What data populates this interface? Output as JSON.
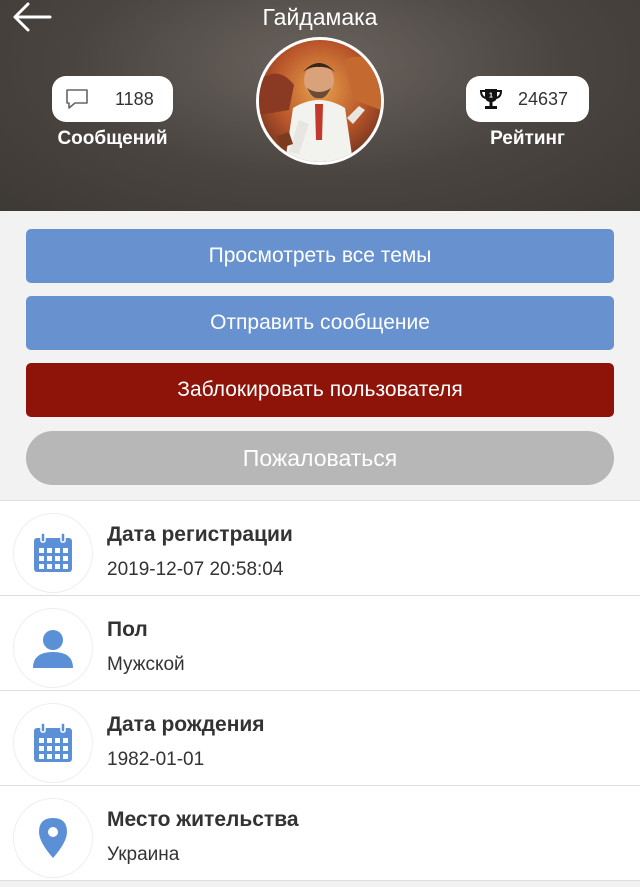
{
  "header": {
    "title": "Гайдамака",
    "messages": {
      "count": "1188",
      "label": "Сообщений",
      "icon": "speech-bubble-icon"
    },
    "rating": {
      "value": "24637",
      "label": "Рейтинг",
      "icon": "trophy-icon"
    },
    "back_icon": "arrow-left-icon"
  },
  "actions": {
    "view_topics": "Просмотреть все темы",
    "send_message": "Отправить сообщение",
    "block_user": "Заблокировать пользователя",
    "report": "Пожаловаться"
  },
  "info": [
    {
      "title": "Дата регистрации",
      "value": "2019-12-07 20:58:04",
      "icon": "calendar-icon"
    },
    {
      "title": "Пол",
      "value": "Мужской",
      "icon": "user-icon"
    },
    {
      "title": "Дата рождения",
      "value": "1982-01-01",
      "icon": "calendar-icon"
    },
    {
      "title": "Место жительства",
      "value": "Украина",
      "icon": "location-pin-icon"
    }
  ],
  "colors": {
    "primary_button": "#6792cf",
    "danger_button": "#8e1309",
    "disabled_button": "#b7b7b7",
    "icon_blue": "#5b8fd6"
  }
}
